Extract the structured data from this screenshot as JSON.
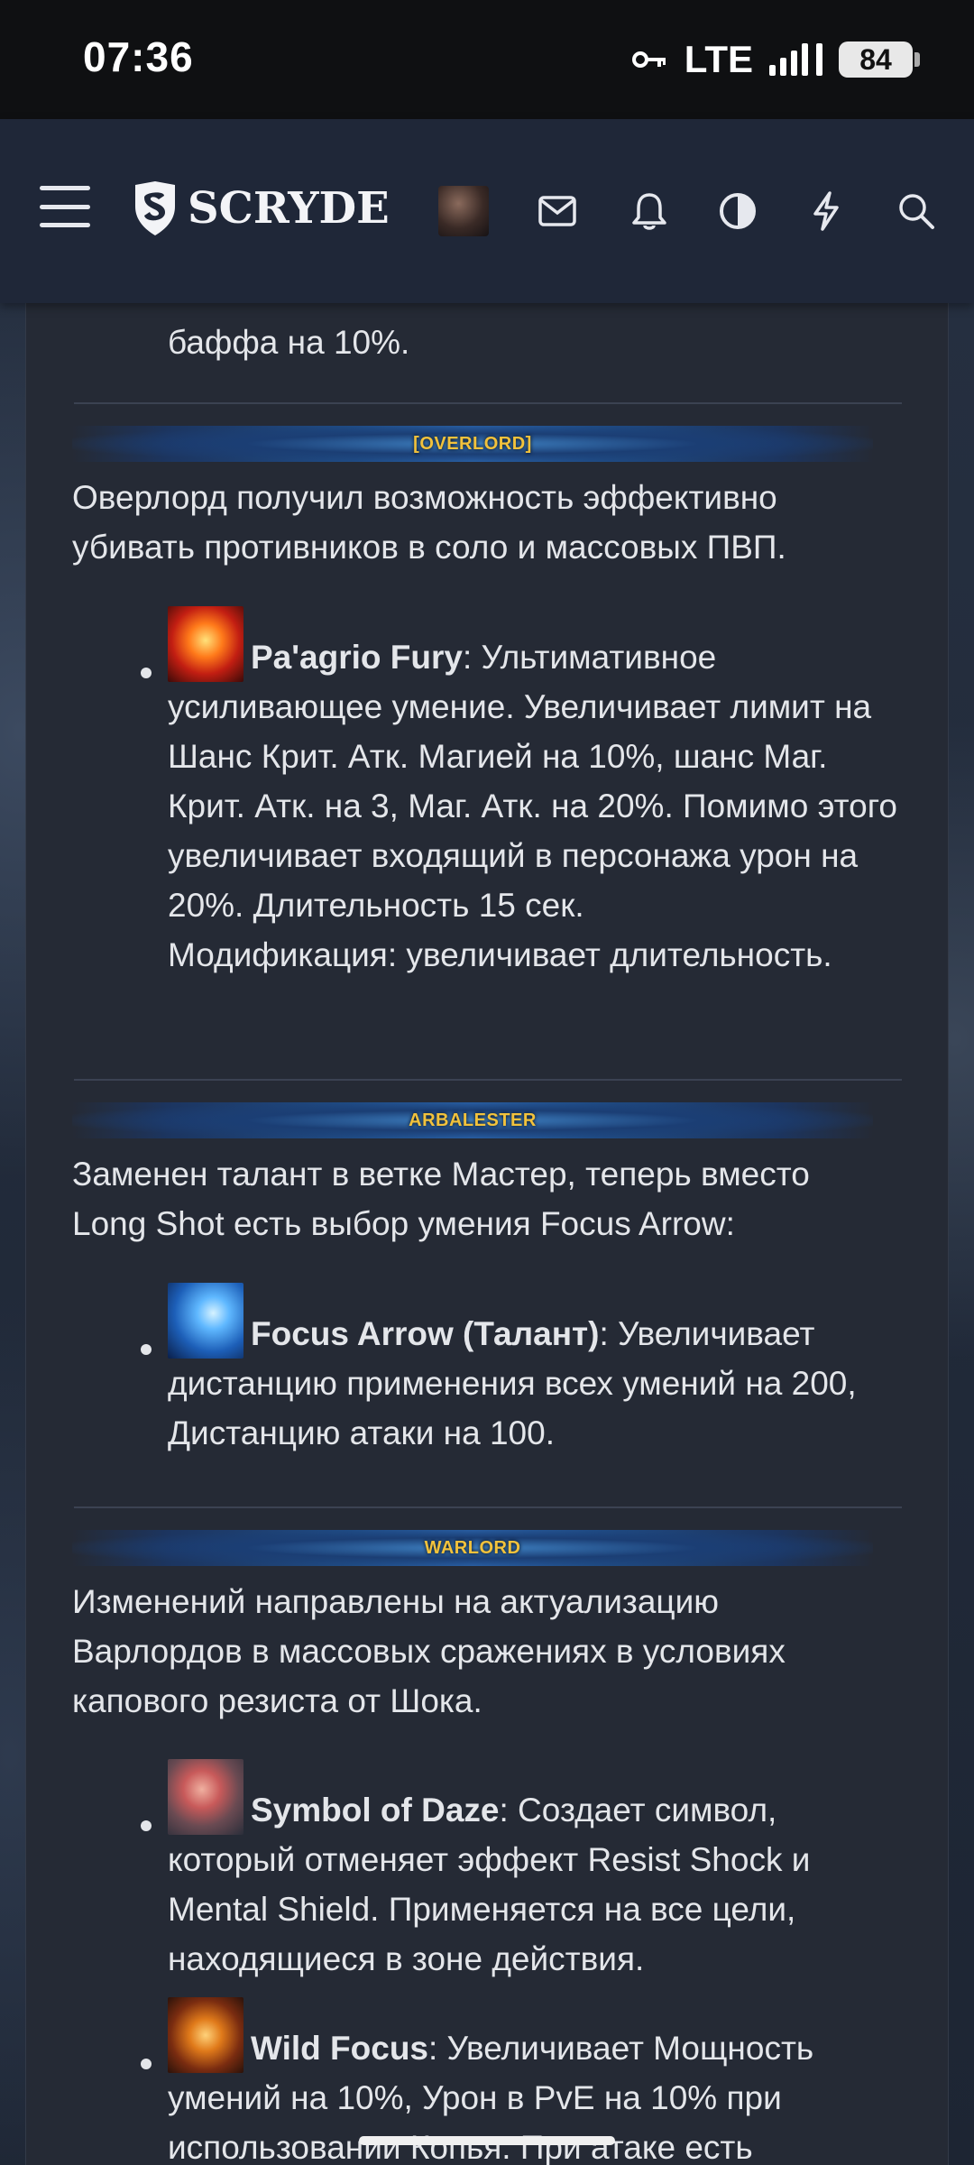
{
  "status": {
    "time": "07:36",
    "network": "LTE",
    "battery": "84"
  },
  "header": {
    "logo": "SCRYDE",
    "icons": [
      "menu-icon",
      "avatar",
      "mail-icon",
      "bell-icon",
      "contrast-icon",
      "lightning-icon",
      "search-icon"
    ]
  },
  "article": {
    "top_fragment": "баффа на 10%.",
    "sections": [
      {
        "banner": "[OVERLORD]",
        "intro": "Оверлорд получил возможность эффективно убивать противников в соло и массовых ПВП.",
        "items": [
          {
            "name": "Pa'agrio Fury",
            "text": ": Ультимативное усиливающее умение. Увеличивает лимит на Шанс Крит. Атк. Магией на 10%, шанс Маг. Крит. Атк. на 3, Маг. Атк. на 20%. Помимо этого увеличивает входящий в персонажа урон на 20%. Длительность 15 сек.",
            "mod": "Модификация: увеличивает длительность."
          }
        ]
      },
      {
        "banner": "ARBALESTER",
        "intro": "Заменен талант в ветке Мастер, теперь вместо Long Shot есть выбор умения Focus Arrow:",
        "items": [
          {
            "name": "Focus Arrow (Талант)",
            "text": ": Увеличивает дистанцию применения всех умений на 200, Дистанцию атаки на 100."
          }
        ]
      },
      {
        "banner": "WARLORD",
        "intro": "Изменений направлены на актуализацию Варлордов в массовых сражениях в условиях капового резиста от Шока.",
        "items": [
          {
            "name": "Symbol of Daze",
            "text": ": Создает символ, который отменяет эффект Resist Shock и Mental Shield. Применяется на все цели, находящиеся в зоне действия."
          },
          {
            "name": "Wild Focus",
            "text": ": Увеличивает Мощность умений на 10%, Урон в PvE на 10% при использовании Копья. При атаке есть"
          }
        ]
      }
    ]
  }
}
